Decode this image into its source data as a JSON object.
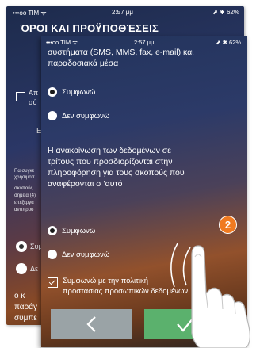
{
  "back_screen": {
    "status": {
      "carrier": "•••oo TIM ᯤ",
      "time": "2:57 μμ",
      "battery": "⬈ ✱ 62%"
    },
    "title": "ΌΡΟΙ ΚΑΙ ΠΡΟΫΠΟΘΈΣΕΙΣ",
    "fragments": [
      "Απ",
      "σύ",
      "Ε",
      "Για συγκε",
      "χρησιμοπ",
      "σκοπούς",
      "σημεία (4)",
      "επεξεργα",
      "αντιπροσ",
      "Συμ",
      "Δε",
      "ο κ",
      "παράγ",
      "συμπε"
    ]
  },
  "front_screen": {
    "status": {
      "carrier": "•••oo TIM ᯤ",
      "time": "2:57 μμ",
      "battery": "⬈ ✱ 62%"
    },
    "top_text_1": "συστήματα (SMS, MMS, fax, e-mail) και",
    "top_text_2": "παραδοσιακά μέσα",
    "radio_group_1": {
      "agree": "Συμφωνώ",
      "disagree": "Δεν συμφωνώ"
    },
    "paragraph": [
      "Η ανακοίνωση των δεδομένων σε",
      "τρίτους που προσδιορίζονται στην",
      "πληροφόρηση για τους σκοπούς που",
      "αναφέρονται σ 'αυτό"
    ],
    "radio_group_2": {
      "agree": "Συμφωνώ",
      "disagree": "Δεν συμφωνώ"
    },
    "checkbox_label_1": "Συμφωνώ με την πολιτική",
    "checkbox_label_2": "προστασίας προσωπικών δεδομένων"
  },
  "step_badge": "2",
  "colors": {
    "confirm": "#5bb16d",
    "back": "#9aa3a6",
    "badge": "#f07a20"
  }
}
